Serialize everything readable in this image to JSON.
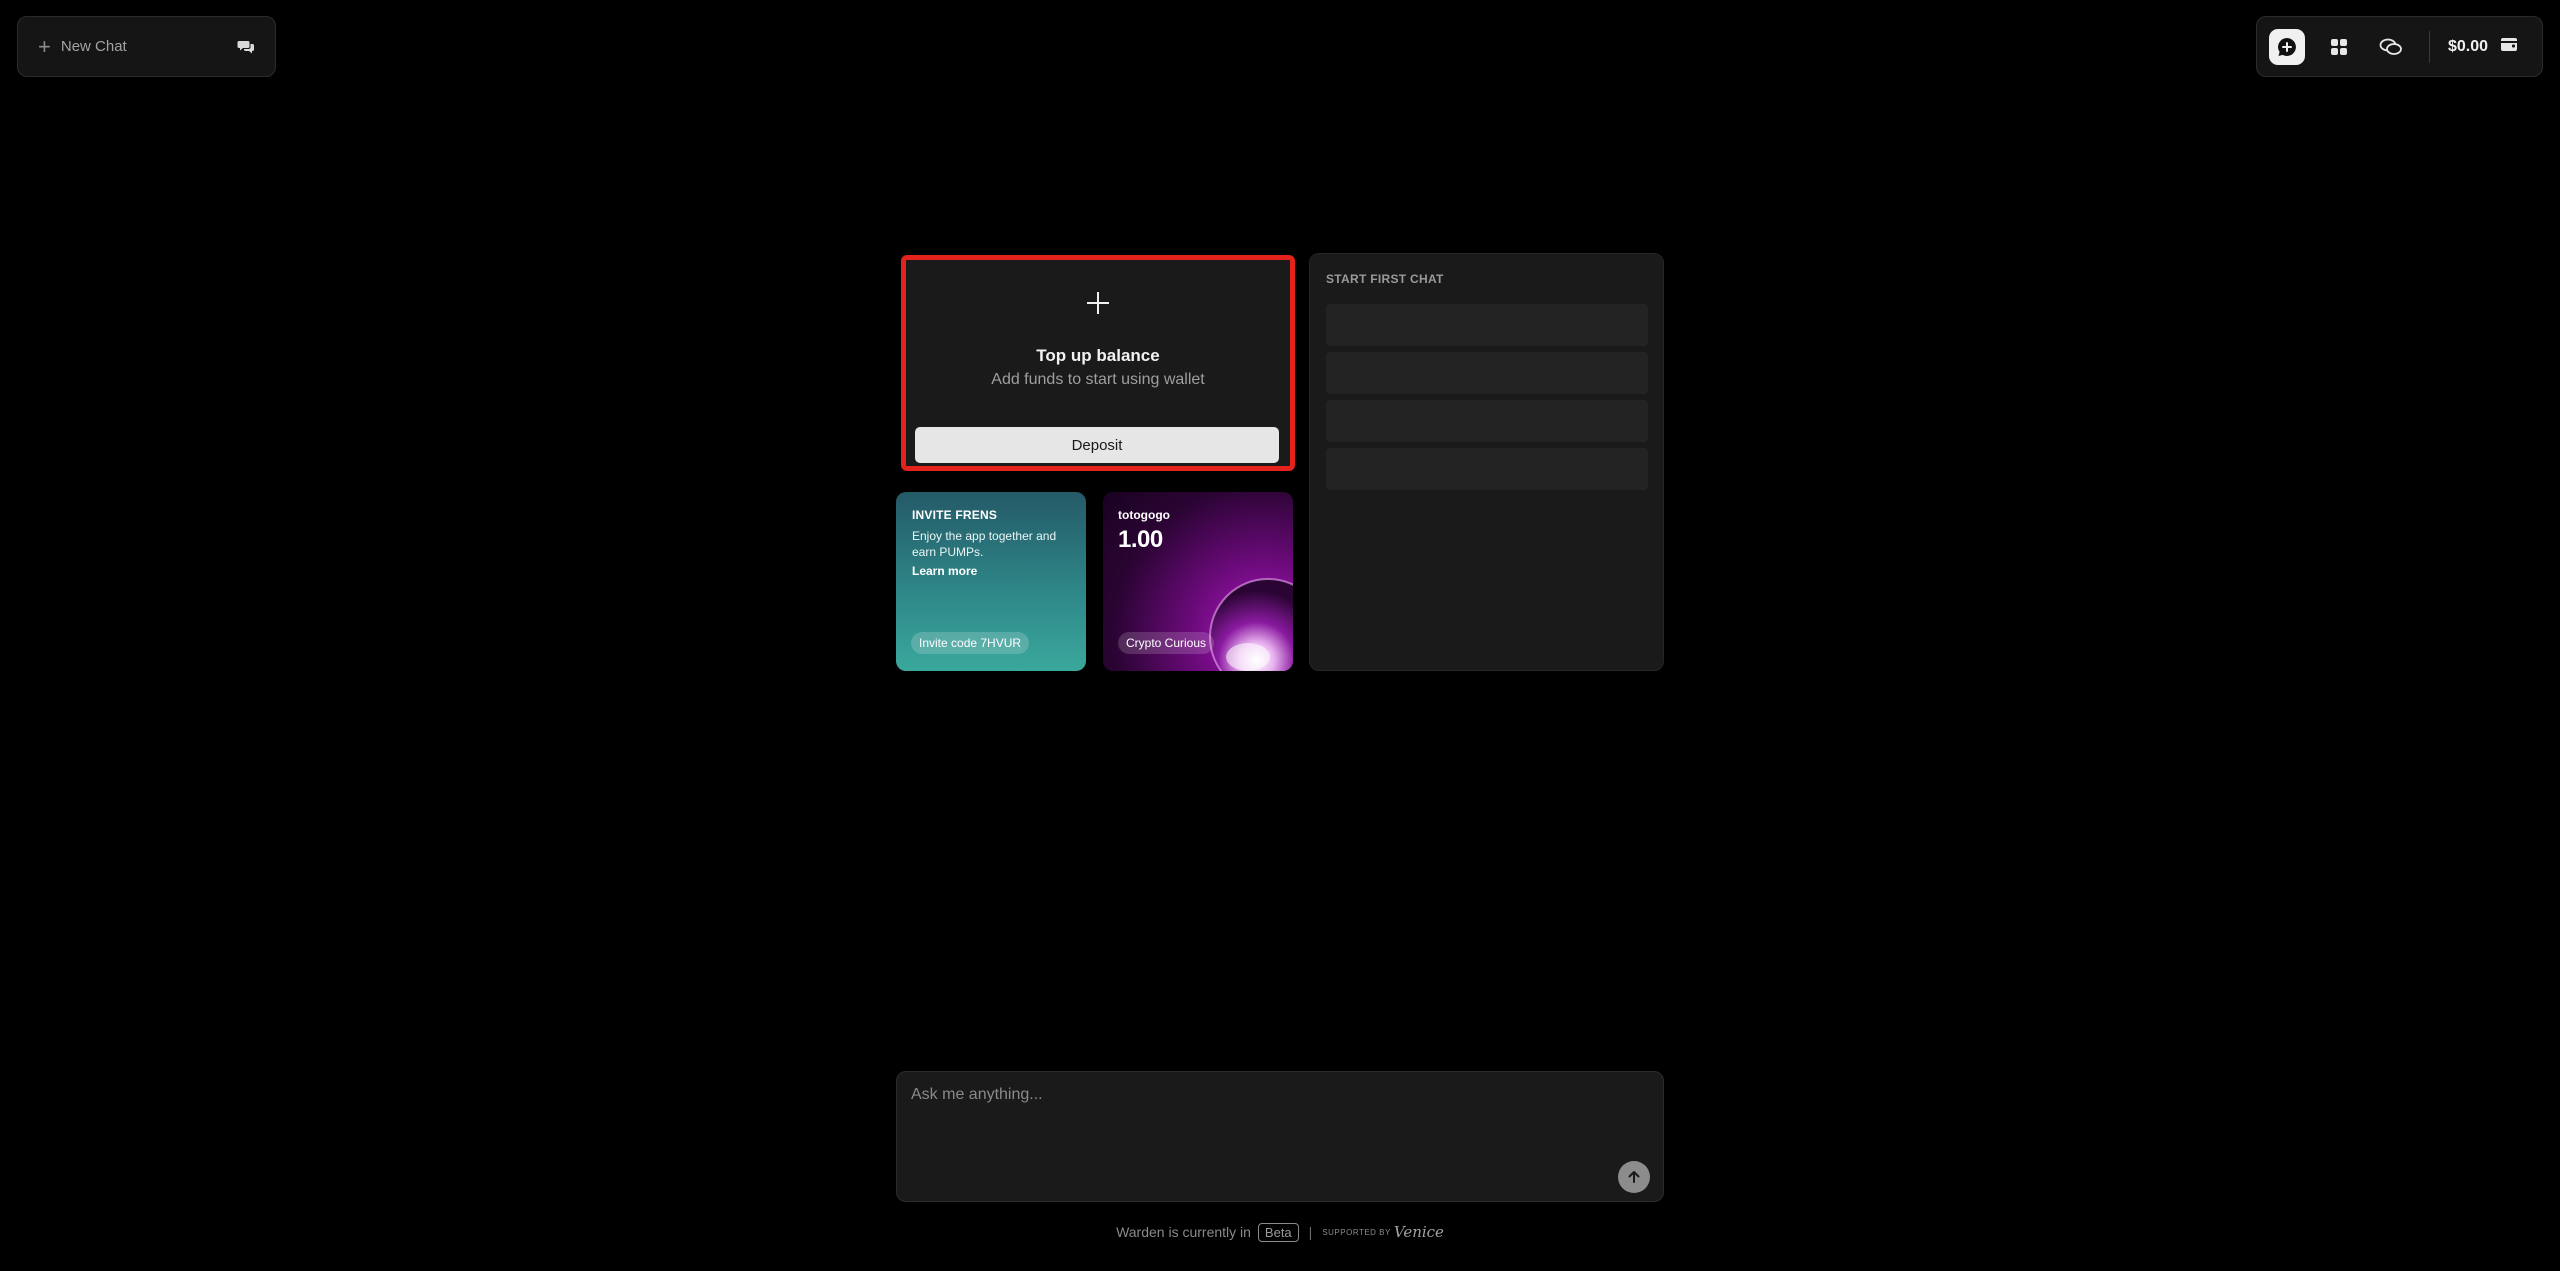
{
  "new_chat": {
    "label": "New Chat"
  },
  "toolbar": {
    "buttons": [
      "new-chat-icon",
      "apps-icon",
      "chats-icon"
    ],
    "balance": "$0.00"
  },
  "topup_card": {
    "title": "Top up balance",
    "subtitle": "Add funds to start using wallet",
    "button_label": "Deposit"
  },
  "invite_card": {
    "heading": "INVITE FRENS",
    "description": "Enjoy the app together and earn PUMPs.",
    "link": "Learn more",
    "code": "Invite code 7HVUR"
  },
  "token_card": {
    "name": "totogogo",
    "value": "1.00",
    "badge": "Crypto Curious"
  },
  "first_chat": {
    "heading": "START FIRST CHAT",
    "items": [
      "",
      "",
      "",
      ""
    ]
  },
  "composer": {
    "placeholder": "Ask me anything..."
  },
  "footer": {
    "text": "Warden is currently in",
    "beta": "Beta",
    "supported_by": "SUPPORTED BY",
    "brand": "Venice"
  },
  "colors": {
    "background": "#000000",
    "highlight_border": "#e3221c",
    "invite_gradient_end": "#3aa89c",
    "token_accent": "#b01ac4"
  }
}
